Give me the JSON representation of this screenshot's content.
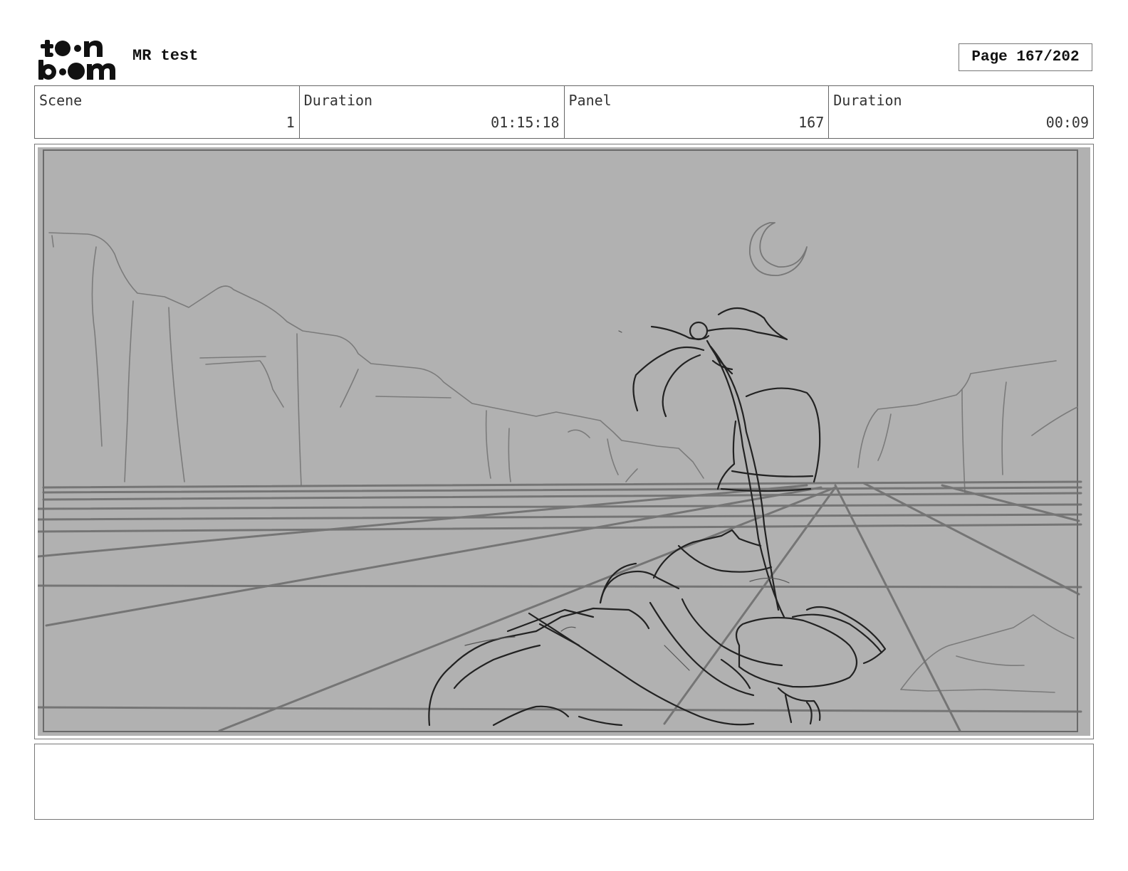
{
  "header": {
    "logo": {
      "icon": "toon-boom-logo",
      "text": "toon boom"
    },
    "project_title": "MR test",
    "page_label": "Page 167/202"
  },
  "info": {
    "scene_label": "Scene",
    "scene_value": "1",
    "scene_duration_label": "Duration",
    "scene_duration_value": "01:15:18",
    "panel_label": "Panel",
    "panel_value": "167",
    "panel_duration_label": "Duration",
    "panel_duration_value": "00:09"
  },
  "panel": {
    "image_icon": "storyboard-sketch",
    "background_color": "#b1b1b1"
  },
  "notes": {
    "text": ""
  }
}
